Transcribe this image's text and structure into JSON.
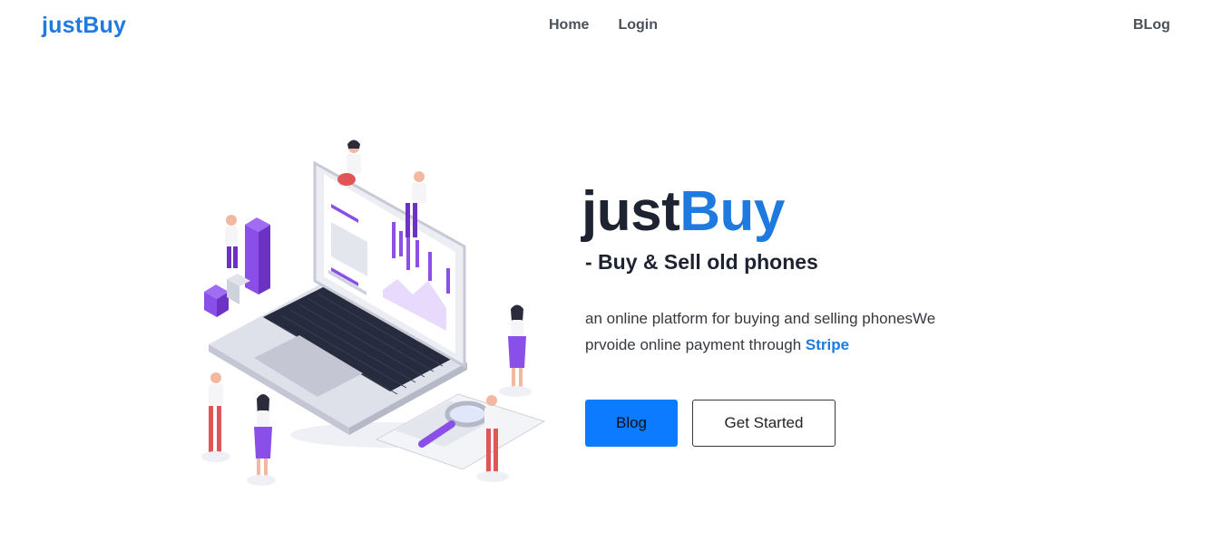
{
  "navbar": {
    "brand": "justBuy",
    "links": [
      "Home",
      "Login"
    ],
    "right_link": "BLog"
  },
  "hero": {
    "title_part1": "just",
    "title_part2": "Buy",
    "subtitle": "- Buy & Sell old phones",
    "description": "an online platform for buying and selling phonesWe prvoide online payment through ",
    "highlight": "Stripe",
    "buttons": {
      "primary": "Blog",
      "secondary": "Get Started"
    }
  },
  "colors": {
    "accent": "#1f7ae0",
    "primary_button": "#0d7bff",
    "purple": "#8a4fe8",
    "dark": "#1d2330"
  },
  "illustration": {
    "icon": "laptop-analytics-illustration"
  }
}
